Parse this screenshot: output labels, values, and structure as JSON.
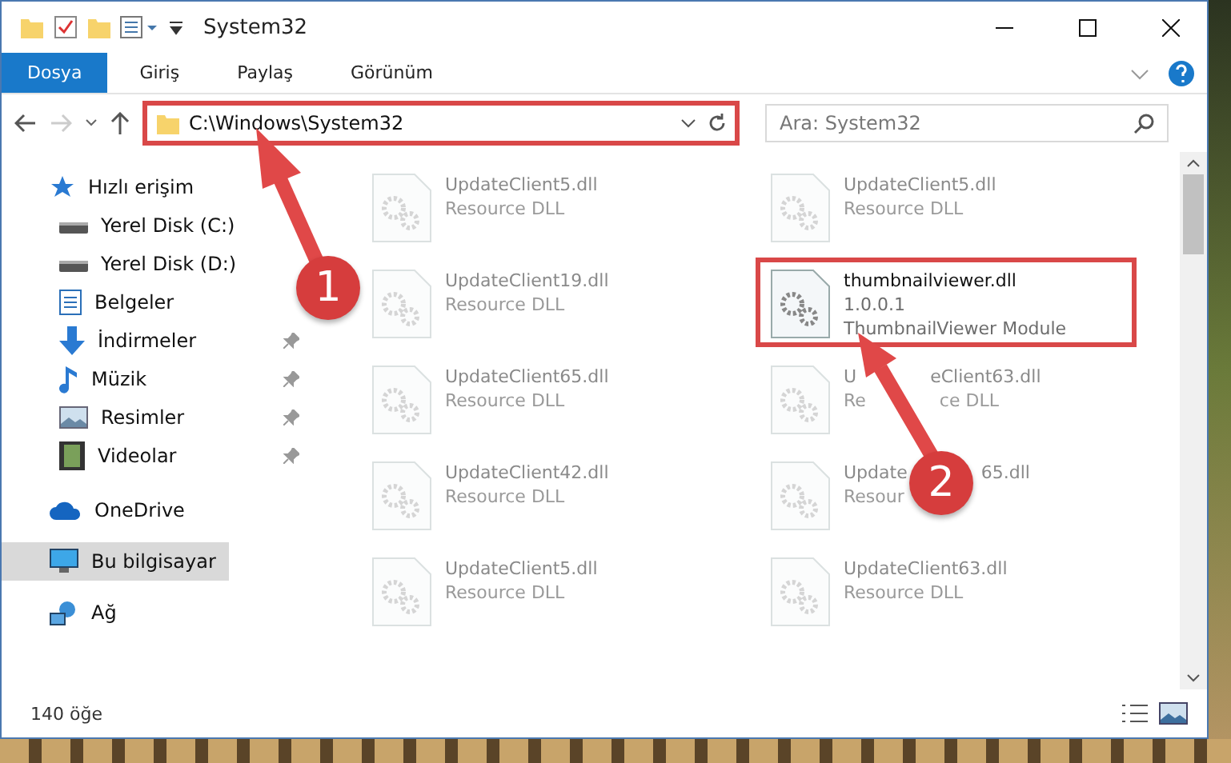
{
  "window": {
    "title": "System32"
  },
  "ribbon_tabs": [
    {
      "label": "Dosya",
      "selected": true
    },
    {
      "label": "Giriş",
      "selected": false
    },
    {
      "label": "Paylaş",
      "selected": false
    },
    {
      "label": "Görünüm",
      "selected": false
    }
  ],
  "address_bar": {
    "path": "C:\\Windows\\System32",
    "highlighted": true
  },
  "search": {
    "placeholder": "Ara: System32"
  },
  "sidebar": {
    "items": [
      {
        "label": "Hızlı erişim",
        "selected": false,
        "children": [
          {
            "label": "Yerel Disk (C:)"
          },
          {
            "label": "Yerel Disk (D:)"
          },
          {
            "label": "Belgeler"
          },
          {
            "label": "İndirmeler",
            "pinned": true
          },
          {
            "label": "Müzik",
            "pinned": true
          },
          {
            "label": "Resimler",
            "pinned": true
          },
          {
            "label": "Videolar",
            "pinned": true
          }
        ]
      },
      {
        "label": "OneDrive",
        "selected": false
      },
      {
        "label": "Bu bilgisayar",
        "selected": true
      },
      {
        "label": "Ağ",
        "selected": false
      }
    ]
  },
  "files": [
    {
      "name": [
        "UpdateClient5.dll"
      ],
      "lines": [
        [
          "Resource DLL"
        ]
      ],
      "kind": "faded"
    },
    {
      "name": [
        "UpdateClient5.dll"
      ],
      "lines": [
        [
          "Resource DLL"
        ]
      ],
      "kind": "faded"
    },
    {
      "name": [
        "UpdateClient19.dll"
      ],
      "lines": [
        [
          "Resource DLL"
        ]
      ],
      "kind": "faded"
    },
    {
      "name": [
        "thumbnailviewer.dll"
      ],
      "lines": [
        [
          "1.0.0.1"
        ],
        [
          "ThumbnailViewer Module"
        ]
      ],
      "kind": "highlighted"
    },
    {
      "name": [
        "UpdateClient65.dll"
      ],
      "lines": [
        [
          "Resource DLL"
        ]
      ],
      "kind": "faded"
    },
    {
      "name": [
        "U",
        "eClient63.dll"
      ],
      "lines": [
        [
          "Re",
          "ce DLL"
        ]
      ],
      "kind": "faded"
    },
    {
      "name": [
        "UpdateClient42.dll"
      ],
      "lines": [
        [
          "Resource DLL"
        ]
      ],
      "kind": "faded"
    },
    {
      "name": [
        "Update",
        "65.dll"
      ],
      "lines": [
        [
          "Resour"
        ]
      ],
      "kind": "faded"
    },
    {
      "name": [
        "UpdateClient5.dll"
      ],
      "lines": [
        [
          "Resource DLL"
        ]
      ],
      "kind": "faded"
    },
    {
      "name": [
        "UpdateClient63.dll"
      ],
      "lines": [
        [
          "Resource DLL"
        ]
      ],
      "kind": "faded"
    }
  ],
  "status_bar": {
    "count": "140 öğe"
  },
  "annotations": [
    {
      "number": "1"
    },
    {
      "number": "2"
    }
  ]
}
